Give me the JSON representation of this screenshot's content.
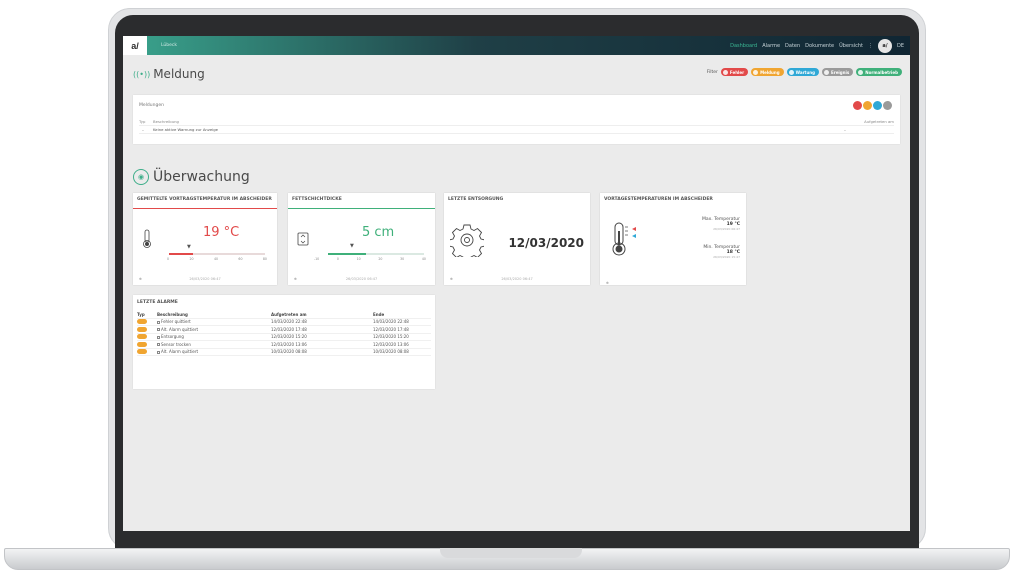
{
  "topbar": {
    "logo": "a/",
    "crumb": "Lübeck",
    "nav": [
      "Dashboard",
      "Alarme",
      "Daten",
      "Dokumente",
      "Übersicht"
    ],
    "menu_glyph": "⋮",
    "avatar": "a/",
    "lang": "DE"
  },
  "meldung": {
    "title": "Meldung",
    "filter_label": "Filter",
    "filters": [
      {
        "label": "Fehler",
        "color": "#e24a4a"
      },
      {
        "label": "Meldung",
        "color": "#f0a531"
      },
      {
        "label": "Wartung",
        "color": "#2fa8d6"
      },
      {
        "label": "Ereignis",
        "color": "#9a9a9a"
      },
      {
        "label": "Normalbetrieb",
        "color": "#3fb07a"
      }
    ],
    "panel_title": "Meldungen",
    "circle_colors": [
      "#e24a4a",
      "#f0a531",
      "#2fa8d6",
      "#9a9a9a"
    ],
    "col_typ": "Typ",
    "col_beschreibung": "Beschreibung",
    "col_aufgetreten": "Aufgetreten am",
    "row_typ": "–",
    "row_text": "Keine aktive Warnung zur Anzeige",
    "row_date": "–"
  },
  "ueberwachung": {
    "title": "Überwachung",
    "cards": {
      "temp": {
        "title": "GEMITTELTE VORTRAGSTEMPERATUR IM ABSCHEIDER",
        "value": "19 °C",
        "ticks": [
          "0",
          "20",
          "40",
          "60",
          "80"
        ],
        "footer": "26/03/2020 06:47",
        "accent": "#e24a4a"
      },
      "fett": {
        "title": "FETTSCHICHTDICKE",
        "value": "5 cm",
        "ticks": [
          "-10",
          "0",
          "10",
          "20",
          "30",
          "40"
        ],
        "footer": "26/03/2020 06:47",
        "accent": "#3fb07a"
      },
      "entsorgung": {
        "title": "LETZTE ENTSORGUNG",
        "value": "12/03/2020",
        "footer": "26/03/2020 06:47"
      },
      "vortrag": {
        "title": "VORTAGESTEMPERATUREN IM ABSCHEIDER",
        "max_label": "Max. Temperatur",
        "max_value": "19 °C",
        "max_date": "26/03/2020 06:47",
        "min_label": "Min. Temperatur",
        "min_value": "18 °C",
        "min_date": "26/03/2020 15:47"
      }
    }
  },
  "alarme": {
    "title": "LETZTE ALARME",
    "columns": [
      "Typ",
      "Beschreibung",
      "Aufgetreten am",
      "Ende"
    ],
    "rows": [
      {
        "beschreibung": "Fehler quittiert",
        "aufgetreten": "14/03/2020 22:48",
        "ende": "14/03/2020 22:48"
      },
      {
        "beschreibung": "Alt. Alarm quittiert",
        "aufgetreten": "12/03/2020 17:48",
        "ende": "12/03/2020 17:48"
      },
      {
        "beschreibung": "Entsorgung",
        "aufgetreten": "12/03/2020 15:20",
        "ende": "12/03/2020 15:20"
      },
      {
        "beschreibung": "Sensor trocken",
        "aufgetreten": "12/03/2020 13:06",
        "ende": "12/03/2020 13:06"
      },
      {
        "beschreibung": "Alt. Alarm quittiert",
        "aufgetreten": "10/03/2020 08:08",
        "ende": "10/03/2020 08:08"
      }
    ]
  }
}
